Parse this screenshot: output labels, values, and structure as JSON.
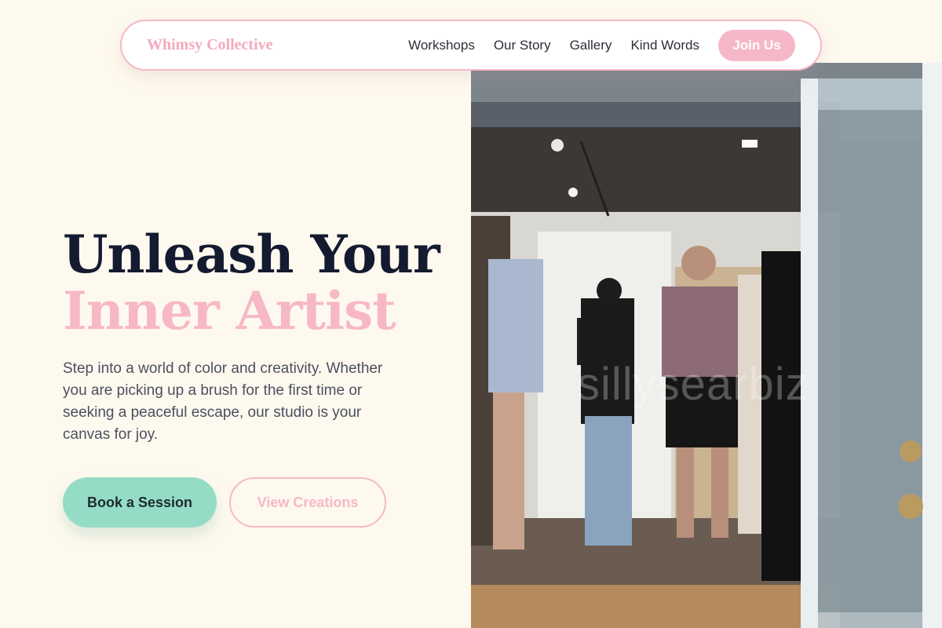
{
  "nav": {
    "brand": "Whimsy Collective",
    "links": [
      "Workshops",
      "Our Story",
      "Gallery",
      "Kind Words"
    ],
    "cta": "Join Us"
  },
  "hero": {
    "title_line1": "Unleash Your",
    "title_line2": "Inner Artist",
    "description": "Step into a world of color and creativity. Whether you are picking up a brush for the first time or seeking a peaceful escape, our studio is your canvas for joy.",
    "primary_button": "Book a Session",
    "secondary_button": "View Creations"
  },
  "photo": {
    "watermark": "sillysearbiz"
  },
  "colors": {
    "background": "#fef9ee",
    "accent_pink": "#f6b8c8",
    "accent_mint": "#95dcc6",
    "headline_dark": "#141a30"
  }
}
